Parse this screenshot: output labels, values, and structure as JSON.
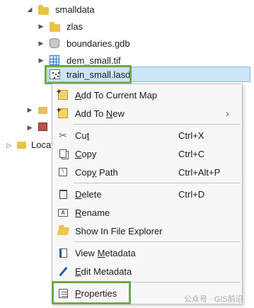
{
  "tree": {
    "items": [
      {
        "label": "smalldata",
        "icon": "folder-icon"
      },
      {
        "label": "zlas",
        "icon": "folder-icon"
      },
      {
        "label": "boundaries.gdb",
        "icon": "geodatabase-icon"
      },
      {
        "label": "dem_small.tif",
        "icon": "raster-icon"
      },
      {
        "label": "train_small.lasd",
        "icon": "las-dataset-icon"
      }
    ],
    "partial_label": "Locat"
  },
  "context_menu": {
    "items": [
      {
        "label": "Add To Current Map",
        "icon": "add-data-icon",
        "shortcut": "",
        "submenu": false
      },
      {
        "label": "Add To New",
        "icon": "add-data-icon",
        "shortcut": "",
        "submenu": true
      },
      {
        "label": "Cut",
        "icon": "scissors-icon",
        "shortcut": "Ctrl+X",
        "submenu": false
      },
      {
        "label": "Copy",
        "icon": "copy-icon",
        "shortcut": "Ctrl+C",
        "submenu": false
      },
      {
        "label": "Copy Path",
        "icon": "copy-path-icon",
        "shortcut": "Ctrl+Alt+P",
        "submenu": false
      },
      {
        "label": "Delete",
        "icon": "trash-icon",
        "shortcut": "Ctrl+D",
        "submenu": false
      },
      {
        "label": "Rename",
        "icon": "rename-icon",
        "shortcut": "",
        "submenu": false
      },
      {
        "label": "Show In File Explorer",
        "icon": "folder-open-icon",
        "shortcut": "",
        "submenu": false
      },
      {
        "label": "View Metadata",
        "icon": "metadata-icon",
        "shortcut": "",
        "submenu": false
      },
      {
        "label": "Edit Metadata",
        "icon": "pencil-icon",
        "shortcut": "",
        "submenu": false
      },
      {
        "label": "Properties",
        "icon": "properties-icon",
        "shortcut": "",
        "submenu": false
      }
    ]
  },
  "watermark": {
    "right": "公众号 · GIS前沿"
  },
  "colors": {
    "highlight_frame": "#70a845",
    "selection": "#cce4f7",
    "folder": "#e9c24a"
  }
}
